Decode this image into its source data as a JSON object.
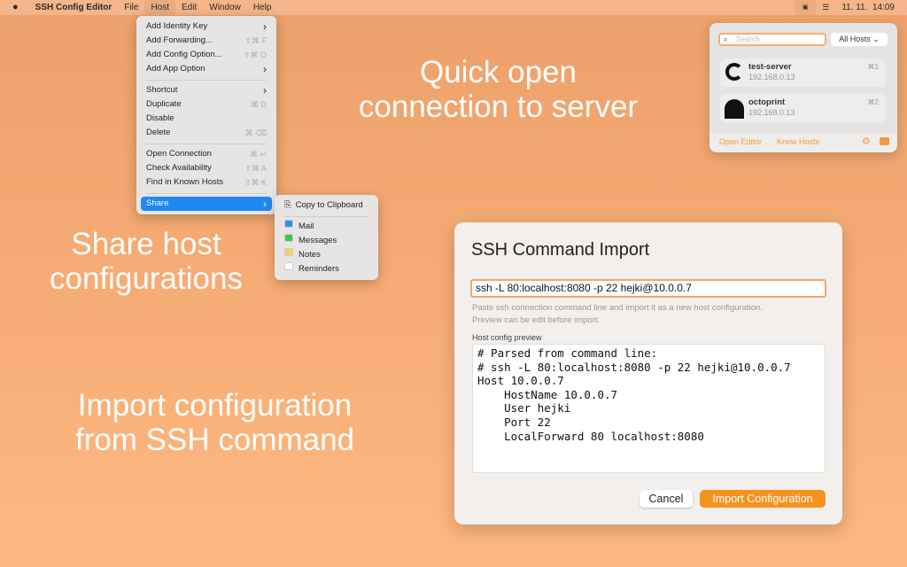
{
  "menubar": {
    "app": "SSH Config Editor",
    "items": [
      "File",
      "Host",
      "Edit",
      "Window",
      "Help"
    ],
    "clock": "11. 11.  14:09"
  },
  "host_menu": {
    "groups": [
      [
        {
          "label": "Add Identity Key",
          "shortcut": "›"
        },
        {
          "label": "Add Forwarding...",
          "shortcut": "⇧⌘ F"
        },
        {
          "label": "Add Config Option...",
          "shortcut": "⇧⌘ O"
        },
        {
          "label": "Add App Option",
          "shortcut": "›"
        }
      ],
      [
        {
          "label": "Shortcut",
          "shortcut": "›"
        },
        {
          "label": "Duplicate",
          "shortcut": "⌘ D"
        },
        {
          "label": "Disable",
          "shortcut": ""
        },
        {
          "label": "Delete",
          "shortcut": "⌘ ⌫"
        }
      ],
      [
        {
          "label": "Open Connection",
          "shortcut": "⌘ ↩"
        },
        {
          "label": "Check Availability",
          "shortcut": "⇧⌘ A"
        },
        {
          "label": "Find in Known Hosts",
          "shortcut": "⇧⌘ K"
        }
      ],
      [
        {
          "label": "Share",
          "shortcut": "›"
        }
      ]
    ]
  },
  "share_menu": {
    "copy": "Copy to Clipboard",
    "items": [
      {
        "label": "Mail",
        "color": "#2f8ef0"
      },
      {
        "label": "Messages",
        "color": "#3cc84a"
      },
      {
        "label": "Notes",
        "color": "#f5d35a"
      },
      {
        "label": "Reminders",
        "color": "#ffffff"
      }
    ]
  },
  "popover": {
    "search_placeholder": "Search",
    "filter": "All Hosts",
    "hosts": [
      {
        "name": "test-server",
        "ip": "192.168.0.13",
        "shortcut": "⌘1",
        "icon": "ubuntu-icon"
      },
      {
        "name": "octoprint",
        "ip": "192.168.0.13",
        "shortcut": "⌘2",
        "icon": "octoprint-icon"
      }
    ],
    "open_editor": "Open Editor",
    "know_hosts": "Know Hosts"
  },
  "captions": {
    "quick": "Quick open\nconnection to server",
    "share": "Share host\nconfigurations",
    "import": "Import configuration\nfrom SSH command"
  },
  "dialog": {
    "title": "SSH Command Import",
    "command": "ssh -L 80:localhost:8080 -p 22 hejki@10.0.0.7",
    "help": "Paste ssh connection command line and import it as a new host configuration.\nPreview can be edit before import.",
    "preview_label": "Host config preview",
    "preview": "# Parsed from command line:\n# ssh -L 80:localhost:8080 -p 22 hejki@10.0.0.7\nHost 10.0.0.7\n    HostName 10.0.0.7\n    User hejki\n    Port 22\n    LocalForward 80 localhost:8080",
    "cancel": "Cancel",
    "import": "Import Configuration"
  },
  "colors": {
    "accent": "#f7921e",
    "selection": "#1e88f0",
    "link": "#f09a40"
  }
}
